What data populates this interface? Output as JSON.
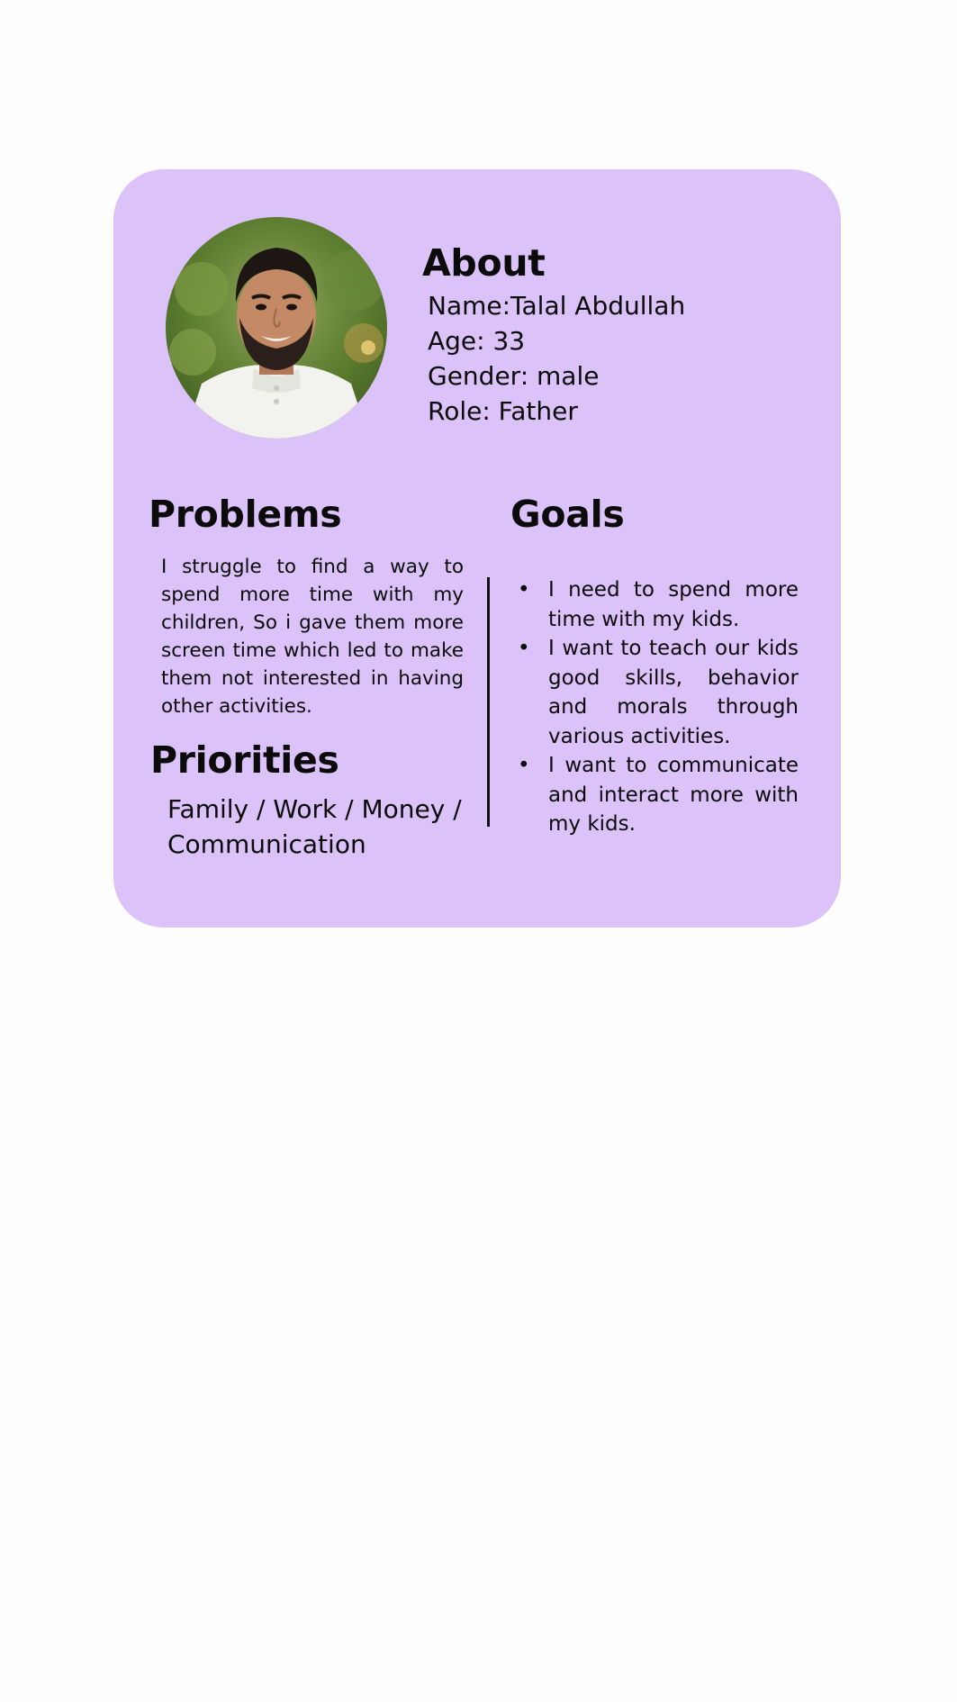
{
  "about": {
    "title": "About",
    "name": "Name:Talal Abdullah",
    "age": "Age: 33",
    "gender": "Gender: male",
    "role": "Role: Father"
  },
  "problems": {
    "title": "Problems",
    "text": "I struggle to find a way to spend more time with my children, So i gave them more screen time which led to make them not interested in having other activities."
  },
  "priorities": {
    "title": "Priorities",
    "text": "Family / Work / Money / Communication"
  },
  "goals": {
    "title": "Goals",
    "items": [
      "I need to spend more time with my kids.",
      "I want to teach our kids good skills, behavior and morals through various activities.",
      "I want to communicate and interact more with my kids."
    ]
  },
  "colors": {
    "card_background": "#dbc2f8",
    "page_background": "#fefefe",
    "text": "#0b0b0b"
  },
  "icons": {
    "bullet": "•"
  }
}
